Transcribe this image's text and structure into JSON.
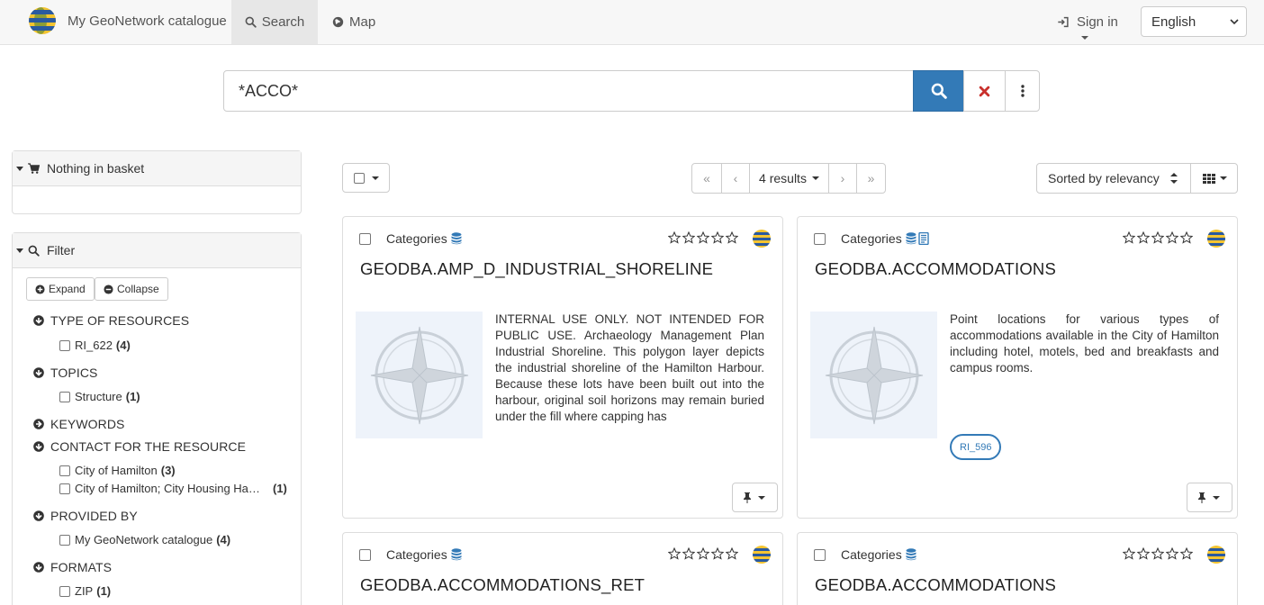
{
  "header": {
    "app_title": "My GeoNetwork catalogue",
    "tabs": [
      {
        "label": "Search",
        "icon": "search-icon"
      },
      {
        "label": "Map",
        "icon": "globe-icon"
      }
    ],
    "signin_label": "Sign in",
    "language": "English"
  },
  "search": {
    "query": "*ACCO*"
  },
  "sidebar": {
    "basket_label": "Nothing in basket",
    "filter_label": "Filter",
    "expand_label": "Expand",
    "collapse_label": "Collapse",
    "facets": [
      {
        "title": "TYPE OF RESOURCES",
        "expanded": true,
        "items": [
          {
            "label": "RI_622",
            "count": "(4)"
          }
        ]
      },
      {
        "title": "TOPICS",
        "expanded": true,
        "items": [
          {
            "label": "Structure",
            "count": "(1)"
          }
        ]
      },
      {
        "title": "KEYWORDS",
        "expanded": false,
        "items": []
      },
      {
        "title": "CONTACT FOR THE RESOURCE",
        "expanded": true,
        "items": [
          {
            "label": "City of Hamilton",
            "count": "(3)"
          },
          {
            "label": "City of Hamilton; City Housing Hamilton",
            "count": "(1)"
          }
        ]
      },
      {
        "title": "PROVIDED BY",
        "expanded": true,
        "items": [
          {
            "label": "My GeoNetwork catalogue",
            "count": "(4)"
          }
        ]
      },
      {
        "title": "FORMATS",
        "expanded": true,
        "items": [
          {
            "label": "ZIP",
            "count": "(1)"
          }
        ]
      }
    ]
  },
  "results": {
    "count_label": "4 results",
    "sort_label": "Sorted by relevancy",
    "records": [
      {
        "categories_label": "Categories",
        "title": "GEODBA.AMP_D_INDUSTRIAL_SHORELINE",
        "abstract": "INTERNAL USE ONLY. NOT INTENDED FOR PUBLIC USE. Archaeology Management Plan Industrial Shoreline. This polygon layer depicts the industrial shoreline of the Hamilton Harbour. Because these lots have been built out into the harbour, original soil horizons may remain buried under the fill where capping has",
        "tag": ""
      },
      {
        "categories_label": "Categories",
        "title": "GEODBA.ACCOMMODATIONS",
        "abstract": "Point locations for various types of accommodations available in the City of Hamilton including hotel, motels, bed and breakfasts and campus rooms.",
        "tag": "RI_596"
      },
      {
        "categories_label": "Categories",
        "title": "GEODBA.ACCOMMODATIONS_RET",
        "abstract": "",
        "tag": ""
      },
      {
        "categories_label": "Categories",
        "title": "GEODBA.ACCOMMODATIONS",
        "abstract": "",
        "tag": ""
      }
    ]
  },
  "colors": {
    "primary": "#337ab7",
    "danger": "#c9302c",
    "navbar": "#f7f7f7"
  }
}
